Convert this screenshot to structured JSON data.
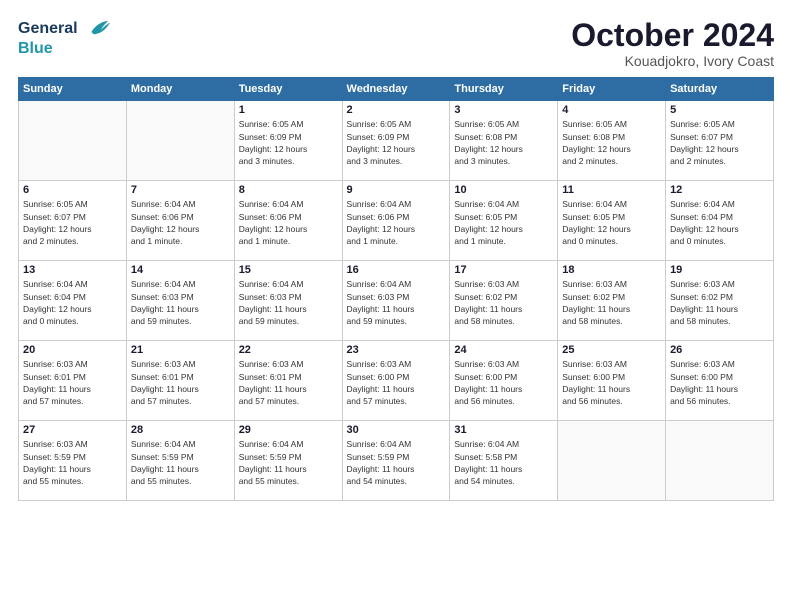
{
  "header": {
    "logo_line1": "General",
    "logo_line2": "Blue",
    "month": "October 2024",
    "location": "Kouadjokro, Ivory Coast"
  },
  "weekdays": [
    "Sunday",
    "Monday",
    "Tuesday",
    "Wednesday",
    "Thursday",
    "Friday",
    "Saturday"
  ],
  "weeks": [
    [
      {
        "day": "",
        "info": ""
      },
      {
        "day": "",
        "info": ""
      },
      {
        "day": "1",
        "info": "Sunrise: 6:05 AM\nSunset: 6:09 PM\nDaylight: 12 hours\nand 3 minutes."
      },
      {
        "day": "2",
        "info": "Sunrise: 6:05 AM\nSunset: 6:09 PM\nDaylight: 12 hours\nand 3 minutes."
      },
      {
        "day": "3",
        "info": "Sunrise: 6:05 AM\nSunset: 6:08 PM\nDaylight: 12 hours\nand 3 minutes."
      },
      {
        "day": "4",
        "info": "Sunrise: 6:05 AM\nSunset: 6:08 PM\nDaylight: 12 hours\nand 2 minutes."
      },
      {
        "day": "5",
        "info": "Sunrise: 6:05 AM\nSunset: 6:07 PM\nDaylight: 12 hours\nand 2 minutes."
      }
    ],
    [
      {
        "day": "6",
        "info": "Sunrise: 6:05 AM\nSunset: 6:07 PM\nDaylight: 12 hours\nand 2 minutes."
      },
      {
        "day": "7",
        "info": "Sunrise: 6:04 AM\nSunset: 6:06 PM\nDaylight: 12 hours\nand 1 minute."
      },
      {
        "day": "8",
        "info": "Sunrise: 6:04 AM\nSunset: 6:06 PM\nDaylight: 12 hours\nand 1 minute."
      },
      {
        "day": "9",
        "info": "Sunrise: 6:04 AM\nSunset: 6:06 PM\nDaylight: 12 hours\nand 1 minute."
      },
      {
        "day": "10",
        "info": "Sunrise: 6:04 AM\nSunset: 6:05 PM\nDaylight: 12 hours\nand 1 minute."
      },
      {
        "day": "11",
        "info": "Sunrise: 6:04 AM\nSunset: 6:05 PM\nDaylight: 12 hours\nand 0 minutes."
      },
      {
        "day": "12",
        "info": "Sunrise: 6:04 AM\nSunset: 6:04 PM\nDaylight: 12 hours\nand 0 minutes."
      }
    ],
    [
      {
        "day": "13",
        "info": "Sunrise: 6:04 AM\nSunset: 6:04 PM\nDaylight: 12 hours\nand 0 minutes."
      },
      {
        "day": "14",
        "info": "Sunrise: 6:04 AM\nSunset: 6:03 PM\nDaylight: 11 hours\nand 59 minutes."
      },
      {
        "day": "15",
        "info": "Sunrise: 6:04 AM\nSunset: 6:03 PM\nDaylight: 11 hours\nand 59 minutes."
      },
      {
        "day": "16",
        "info": "Sunrise: 6:04 AM\nSunset: 6:03 PM\nDaylight: 11 hours\nand 59 minutes."
      },
      {
        "day": "17",
        "info": "Sunrise: 6:03 AM\nSunset: 6:02 PM\nDaylight: 11 hours\nand 58 minutes."
      },
      {
        "day": "18",
        "info": "Sunrise: 6:03 AM\nSunset: 6:02 PM\nDaylight: 11 hours\nand 58 minutes."
      },
      {
        "day": "19",
        "info": "Sunrise: 6:03 AM\nSunset: 6:02 PM\nDaylight: 11 hours\nand 58 minutes."
      }
    ],
    [
      {
        "day": "20",
        "info": "Sunrise: 6:03 AM\nSunset: 6:01 PM\nDaylight: 11 hours\nand 57 minutes."
      },
      {
        "day": "21",
        "info": "Sunrise: 6:03 AM\nSunset: 6:01 PM\nDaylight: 11 hours\nand 57 minutes."
      },
      {
        "day": "22",
        "info": "Sunrise: 6:03 AM\nSunset: 6:01 PM\nDaylight: 11 hours\nand 57 minutes."
      },
      {
        "day": "23",
        "info": "Sunrise: 6:03 AM\nSunset: 6:00 PM\nDaylight: 11 hours\nand 57 minutes."
      },
      {
        "day": "24",
        "info": "Sunrise: 6:03 AM\nSunset: 6:00 PM\nDaylight: 11 hours\nand 56 minutes."
      },
      {
        "day": "25",
        "info": "Sunrise: 6:03 AM\nSunset: 6:00 PM\nDaylight: 11 hours\nand 56 minutes."
      },
      {
        "day": "26",
        "info": "Sunrise: 6:03 AM\nSunset: 6:00 PM\nDaylight: 11 hours\nand 56 minutes."
      }
    ],
    [
      {
        "day": "27",
        "info": "Sunrise: 6:03 AM\nSunset: 5:59 PM\nDaylight: 11 hours\nand 55 minutes."
      },
      {
        "day": "28",
        "info": "Sunrise: 6:04 AM\nSunset: 5:59 PM\nDaylight: 11 hours\nand 55 minutes."
      },
      {
        "day": "29",
        "info": "Sunrise: 6:04 AM\nSunset: 5:59 PM\nDaylight: 11 hours\nand 55 minutes."
      },
      {
        "day": "30",
        "info": "Sunrise: 6:04 AM\nSunset: 5:59 PM\nDaylight: 11 hours\nand 54 minutes."
      },
      {
        "day": "31",
        "info": "Sunrise: 6:04 AM\nSunset: 5:58 PM\nDaylight: 11 hours\nand 54 minutes."
      },
      {
        "day": "",
        "info": ""
      },
      {
        "day": "",
        "info": ""
      }
    ]
  ]
}
